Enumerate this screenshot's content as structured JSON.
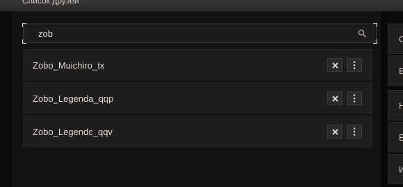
{
  "window": {
    "title": "Список друзей"
  },
  "search": {
    "value": "zob",
    "icon": "search-icon"
  },
  "friends": [
    {
      "name": "Zobo_Muichiro_tx"
    },
    {
      "name": "Zobo_Legenda_qqp"
    },
    {
      "name": "Zobo_Legendc_qqv"
    }
  ],
  "row_actions": {
    "remove_icon": "close-icon",
    "more_icon": "more-vertical-icon"
  },
  "right_panel": {
    "items": [
      "С",
      "В",
      "Н",
      "В",
      "И"
    ]
  },
  "colors": {
    "background": "#0c0b0a",
    "panel": "#141312",
    "row": "#1f1e1c",
    "text": "#dedad4",
    "focus_corner": "#e9e6e0"
  }
}
